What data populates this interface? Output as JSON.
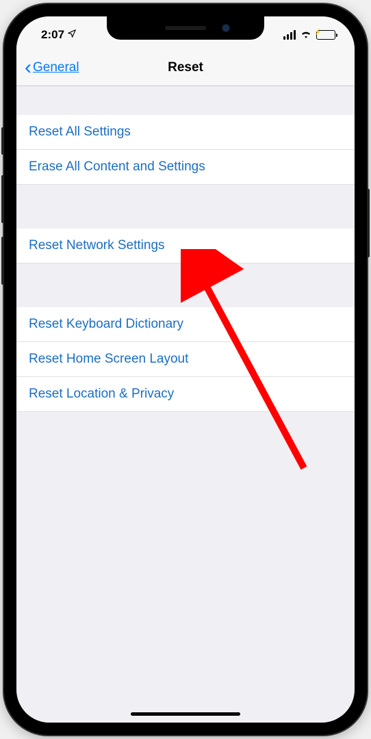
{
  "status_bar": {
    "time": "2:07",
    "location_icon": "location-arrow"
  },
  "nav": {
    "back_label": "General",
    "title": "Reset"
  },
  "sections": [
    {
      "items": [
        {
          "label": "Reset All Settings",
          "key": "reset-all-settings"
        },
        {
          "label": "Erase All Content and Settings",
          "key": "erase-all-content-settings"
        }
      ]
    },
    {
      "items": [
        {
          "label": "Reset Network Settings",
          "key": "reset-network-settings"
        }
      ]
    },
    {
      "items": [
        {
          "label": "Reset Keyboard Dictionary",
          "key": "reset-keyboard-dictionary"
        },
        {
          "label": "Reset Home Screen Layout",
          "key": "reset-home-screen-layout"
        },
        {
          "label": "Reset Location & Privacy",
          "key": "reset-location-privacy"
        }
      ]
    }
  ],
  "annotation": {
    "target": "reset-network-settings",
    "color": "#ff0000"
  }
}
